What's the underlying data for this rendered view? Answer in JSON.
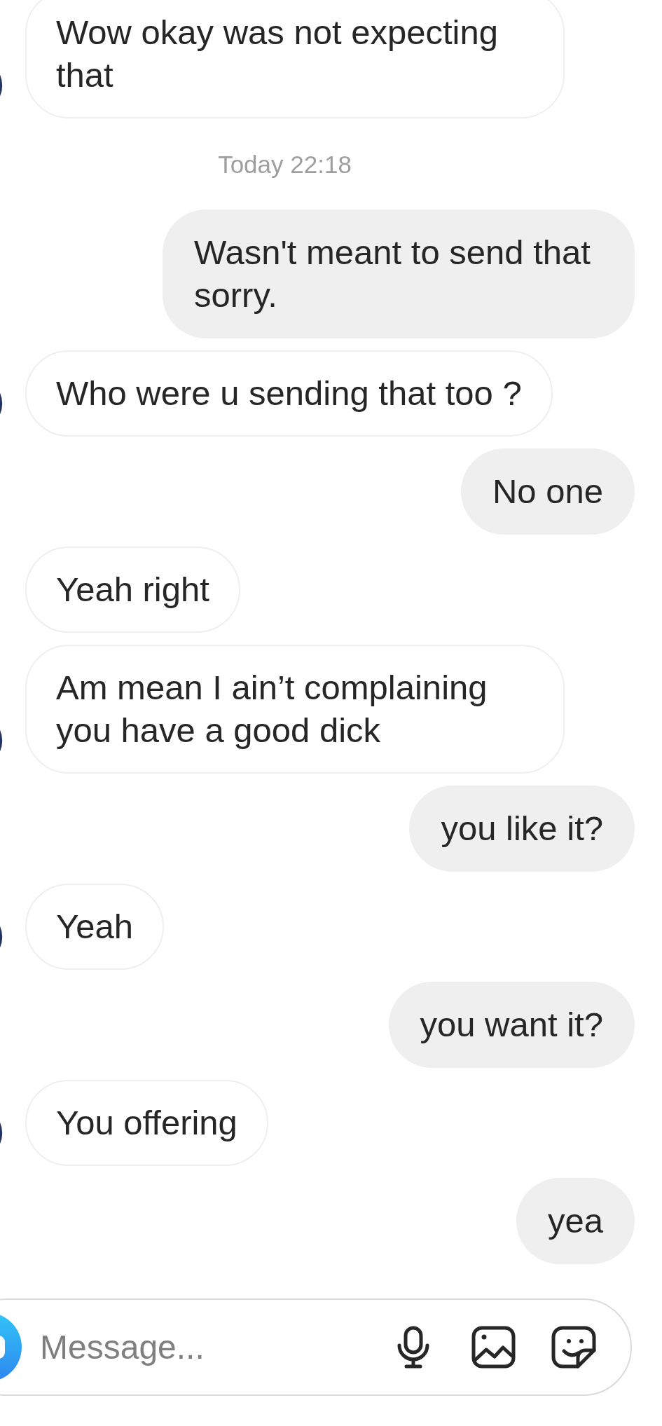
{
  "messages": [
    {
      "kind": "received",
      "text": "Wow okay was not expecting that",
      "avatar": true
    },
    {
      "kind": "timestamp",
      "text": "Today 22:18"
    },
    {
      "kind": "sent",
      "text": "Wasn't meant to send that sorry."
    },
    {
      "kind": "received",
      "text": "Who were u sending that too ?",
      "avatar": true
    },
    {
      "kind": "sent",
      "text": "No one"
    },
    {
      "kind": "received",
      "text": "Yeah right",
      "avatar": false
    },
    {
      "kind": "received",
      "text": "Am mean I ain’t complaining you have a good dick",
      "avatar": true
    },
    {
      "kind": "sent",
      "text": "you like it?"
    },
    {
      "kind": "received",
      "text": "Yeah",
      "avatar": true
    },
    {
      "kind": "sent",
      "text": "you want it?"
    },
    {
      "kind": "received",
      "text": "You offering",
      "avatar": true
    },
    {
      "kind": "sent",
      "text": "yea"
    }
  ],
  "composer": {
    "placeholder": "Message..."
  }
}
